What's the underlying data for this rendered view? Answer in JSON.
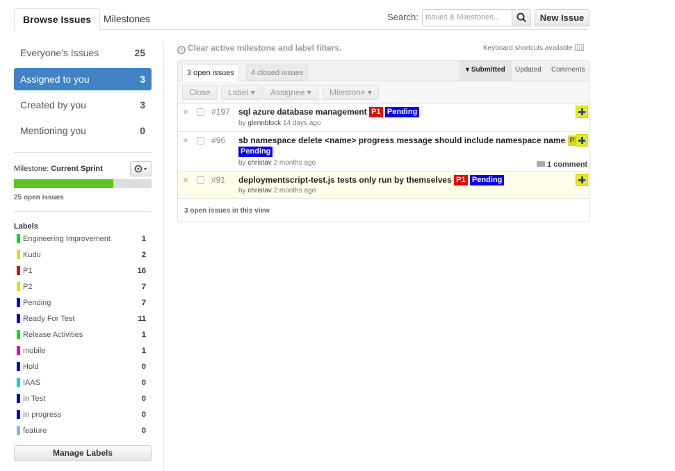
{
  "top_tabs": {
    "browse": "Browse Issues",
    "milestones": "Milestones"
  },
  "search": {
    "label": "Search:",
    "placeholder": "Issues & Milestones..."
  },
  "new_issue_label": "New Issue",
  "filters": [
    {
      "label": "Everyone's Issues",
      "count": "25",
      "selected": false
    },
    {
      "label": "Assigned to you",
      "count": "3",
      "selected": true
    },
    {
      "label": "Created by you",
      "count": "3",
      "selected": false
    },
    {
      "label": "Mentioning you",
      "count": "0",
      "selected": false
    }
  ],
  "milestone": {
    "prefix": "Milestone:",
    "name": "Current Sprint",
    "open_issues": "25 open issues",
    "progress_fraction": 0.72
  },
  "labels_title": "Labels",
  "labels": [
    {
      "name": "Engineering Improvement",
      "count": "1",
      "color": "#02e10c"
    },
    {
      "name": "Kudu",
      "count": "2",
      "color": "#e0e001"
    },
    {
      "name": "P1",
      "count": "16",
      "color": "#e10c02"
    },
    {
      "name": "P2",
      "count": "7",
      "color": "#e0e001"
    },
    {
      "name": "Pending",
      "count": "7",
      "color": "#0b02e1"
    },
    {
      "name": "Ready For Test",
      "count": "11",
      "color": "#0b02e1"
    },
    {
      "name": "Release Activities",
      "count": "1",
      "color": "#02e10c"
    },
    {
      "name": "mobile",
      "count": "1",
      "color": "#e102d8"
    },
    {
      "name": "Hold",
      "count": "0",
      "color": "#0b02e1"
    },
    {
      "name": "IAAS",
      "count": "0",
      "color": "#02d7e1"
    },
    {
      "name": "In Test",
      "count": "0",
      "color": "#0b02e1"
    },
    {
      "name": "In progress",
      "count": "0",
      "color": "#0b02e1"
    },
    {
      "name": "feature",
      "count": "0",
      "color": "#84b6eb"
    }
  ],
  "manage_labels": "Manage Labels",
  "clear_filters": "Clear active milestone and label filters.",
  "keyboard_shortcuts": "Keyboard shortcuts available",
  "state_tabs": {
    "open": "3 open issues",
    "closed": "4 closed issues"
  },
  "sort_tabs": {
    "submitted": "Submitted",
    "updated": "Updated",
    "comments": "Comments"
  },
  "actions": {
    "close": "Close",
    "label": "Label",
    "assignee": "Assignee",
    "milestone": "Milestone"
  },
  "issues": [
    {
      "number": "#197",
      "title": "sql azure database management",
      "tags": [
        "P1",
        "Pending"
      ],
      "meta_prefix": "by",
      "user": "glennblock",
      "time": "14 days ago"
    },
    {
      "number": "#96",
      "title": "sb namespace delete <name> progress message should include namespace name",
      "tags": [
        "P2",
        "Pending"
      ],
      "meta_prefix": "by",
      "user": "christav",
      "time": "2 months ago",
      "comments": "1 comment"
    },
    {
      "number": "#91",
      "title": "deploymentscript-test.js tests only run by themselves",
      "tags": [
        "P1",
        "Pending"
      ],
      "meta_prefix": "by",
      "user": "christav",
      "time": "2 months ago"
    }
  ],
  "view_count": "3 open issues in this view",
  "colors": {
    "accent": "#4183c4",
    "progress": "#65c223",
    "p1": "#e10c02",
    "pending": "#0b02e1",
    "p2": "#e0e001"
  }
}
